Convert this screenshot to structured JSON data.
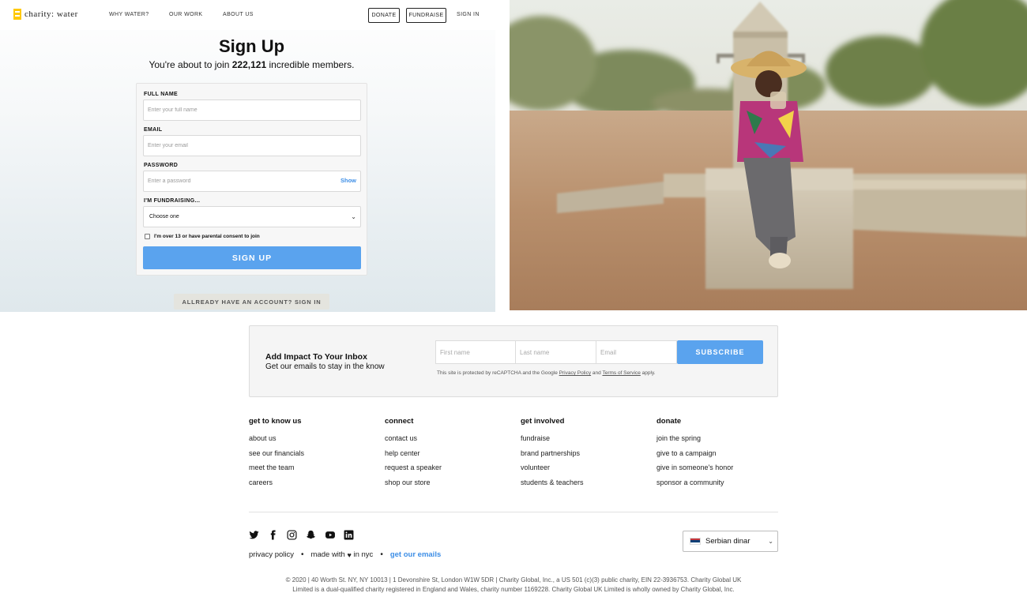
{
  "brand": {
    "logo_text": "charity: water",
    "logo_color": "#ffc907"
  },
  "nav": {
    "links": [
      "WHY WATER?",
      "OUR WORK",
      "ABOUT US"
    ],
    "donate": "DONATE",
    "fundraise": "FUNDRAISE",
    "signin": "SIGN IN"
  },
  "signup": {
    "title": "Sign Up",
    "subtitle_pre": "You're about to join ",
    "member_count": "222,121",
    "subtitle_post": " incredible members.",
    "full_name_label": "FULL NAME",
    "full_name_placeholder": "Enter your full name",
    "email_label": "EMAIL",
    "email_placeholder": "Enter your email",
    "password_label": "PASSWORD",
    "password_placeholder": "Enter a password",
    "show_label": "Show",
    "fundraising_label": "I'M FUNDRAISING...",
    "fundraising_value": "Choose one",
    "consent_label": "I'm over 13 or have parental consent to join",
    "submit_label": "SIGN UP",
    "already_label": "ALLREADY HAVE AN ACCOUNT? SIGN IN",
    "accent": "#5aa3ee"
  },
  "newsletter": {
    "title": "Add Impact To Your Inbox",
    "subtitle": "Get our emails to stay in the know",
    "first_placeholder": "First name",
    "last_placeholder": "Last name",
    "email_placeholder": "Email",
    "button": "SUBSCRIBE",
    "legal_pre": "This site is protected by reCAPTCHA and the Google ",
    "privacy": "Privacy Policy",
    "legal_and": " and ",
    "terms": "Terms of Service",
    "legal_post": " apply."
  },
  "footer": {
    "columns": [
      {
        "title": "get to know us",
        "items": [
          "about us",
          "see our financials",
          "meet the team",
          "careers"
        ]
      },
      {
        "title": "connect",
        "items": [
          "contact us",
          "help center",
          "request a speaker",
          "shop our store"
        ]
      },
      {
        "title": "get involved",
        "items": [
          "fundraise",
          "brand partnerships",
          "volunteer",
          "students & teachers"
        ]
      },
      {
        "title": "donate",
        "items": [
          "join the spring",
          "give to a campaign",
          "give in someone's honor",
          "sponsor a community"
        ]
      }
    ],
    "social_icons": [
      "twitter-icon",
      "facebook-icon",
      "instagram-icon",
      "snapchat-icon",
      "youtube-icon",
      "linkedin-icon"
    ],
    "privacy": "privacy policy",
    "made_pre": "made with",
    "made_post": "in nyc",
    "emails": "get our emails",
    "currency": "Serbian dinar",
    "copyright_1": "© 2020 | 40 Worth St. NY, NY 10013 | 1 Devonshire St, London W1W 5DR | Charity Global, Inc., a US 501 (c)(3) public charity, EIN 22-3936753. Charity Global UK",
    "copyright_2": "Limited is a dual-qualified charity registered in England and Wales, charity number 1169228. Charity Global UK Limited is wholly owned by Charity Global, Inc."
  }
}
